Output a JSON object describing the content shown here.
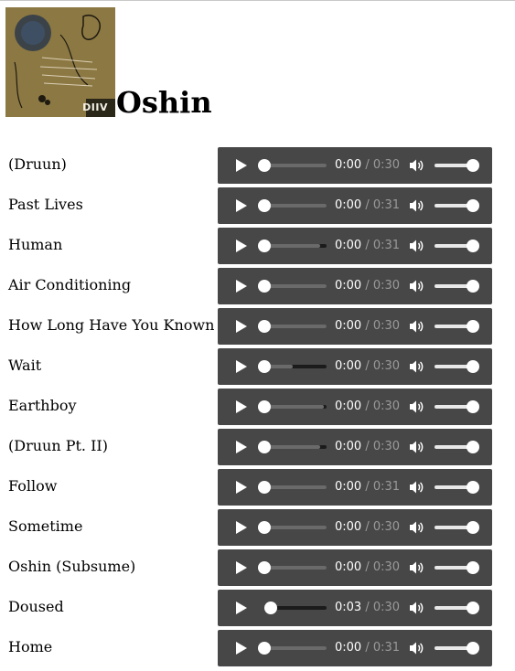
{
  "album": {
    "title": "Oshin",
    "cover_text": "DIIV",
    "cover_alt_icon": "album-cover-image"
  },
  "player_defaults": {
    "play_icon": "play-icon",
    "volume_icon": "volume-icon",
    "time_separator": " / ",
    "volume_level": 1.0
  },
  "tracks": [
    {
      "name": "(Druun)",
      "current": "0:00",
      "duration": "0:30",
      "progress": 0,
      "buffered": 1.0
    },
    {
      "name": "Past Lives",
      "current": "0:00",
      "duration": "0:31",
      "progress": 0,
      "buffered": 1.0
    },
    {
      "name": "Human",
      "current": "0:00",
      "duration": "0:31",
      "progress": 0,
      "buffered": 0.9
    },
    {
      "name": "Air Conditioning",
      "current": "0:00",
      "duration": "0:30",
      "progress": 0,
      "buffered": 1.0
    },
    {
      "name": "How Long Have You Known",
      "current": "0:00",
      "duration": "0:30",
      "progress": 0,
      "buffered": 1.0
    },
    {
      "name": "Wait",
      "current": "0:00",
      "duration": "0:30",
      "progress": 0,
      "buffered": 0.45
    },
    {
      "name": "Earthboy",
      "current": "0:00",
      "duration": "0:30",
      "progress": 0,
      "buffered": 0.95
    },
    {
      "name": "(Druun Pt. II)",
      "current": "0:00",
      "duration": "0:30",
      "progress": 0,
      "buffered": 0.9
    },
    {
      "name": "Follow",
      "current": "0:00",
      "duration": "0:31",
      "progress": 0,
      "buffered": 1.0
    },
    {
      "name": "Sometime",
      "current": "0:00",
      "duration": "0:30",
      "progress": 0,
      "buffered": 1.0
    },
    {
      "name": "Oshin (Subsume)",
      "current": "0:00",
      "duration": "0:30",
      "progress": 0,
      "buffered": 1.0
    },
    {
      "name": "Doused",
      "current": "0:03",
      "duration": "0:30",
      "progress": 0.1,
      "buffered": 0.15
    },
    {
      "name": "Home",
      "current": "0:00",
      "duration": "0:31",
      "progress": 0,
      "buffered": 1.0
    }
  ]
}
